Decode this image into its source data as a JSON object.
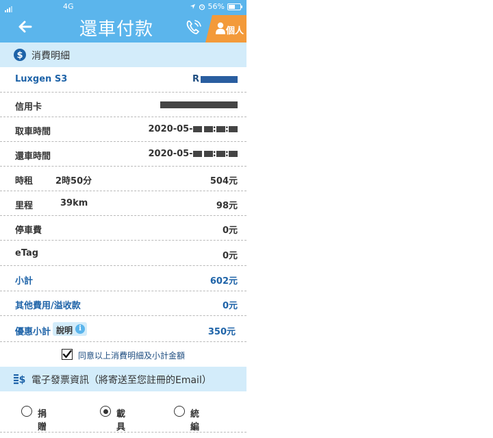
{
  "status": {
    "carrier": "4G",
    "battery": "56%"
  },
  "header": {
    "title": "還車付款",
    "person_label": "個人"
  },
  "section_detail": {
    "title": "消費明細"
  },
  "rows": {
    "car": {
      "label": "Luxgen S3",
      "value_prefix": "R"
    },
    "card": {
      "label": "信用卡"
    },
    "pickup": {
      "label": "取車時間",
      "value_prefix": "2020-05-"
    },
    "return": {
      "label": "還車時間",
      "value_prefix": "2020-05-"
    },
    "rent": {
      "label": "時租",
      "sub": "2時50分",
      "value": "504元"
    },
    "mileage": {
      "label": "里程",
      "sub": "39km",
      "value": "98元"
    },
    "parking": {
      "label": "停車費",
      "value": "0元"
    },
    "etag": {
      "label": "eTag",
      "value": "0元"
    },
    "subtotal": {
      "label": "小計",
      "value": "602元"
    },
    "other": {
      "label": "其他費用/溢收款",
      "value": "0元"
    },
    "discount": {
      "label": "優惠小計",
      "explain": "說明",
      "value": "350元"
    }
  },
  "agree": {
    "text": "同意以上消費明細及小計金額",
    "checked": true
  },
  "section_invoice": {
    "title": "電子發票資訊（將寄送至您註冊的Email）"
  },
  "invoice_options": [
    {
      "label": "捐贈",
      "selected": false
    },
    {
      "label": "載具",
      "selected": true
    },
    {
      "label": "統編",
      "selected": false
    }
  ],
  "colors": {
    "header": "#5bb5ec",
    "section": "#d3ecfa",
    "accent_orange": "#f39a3a",
    "blue_text": "#1e63a8"
  }
}
